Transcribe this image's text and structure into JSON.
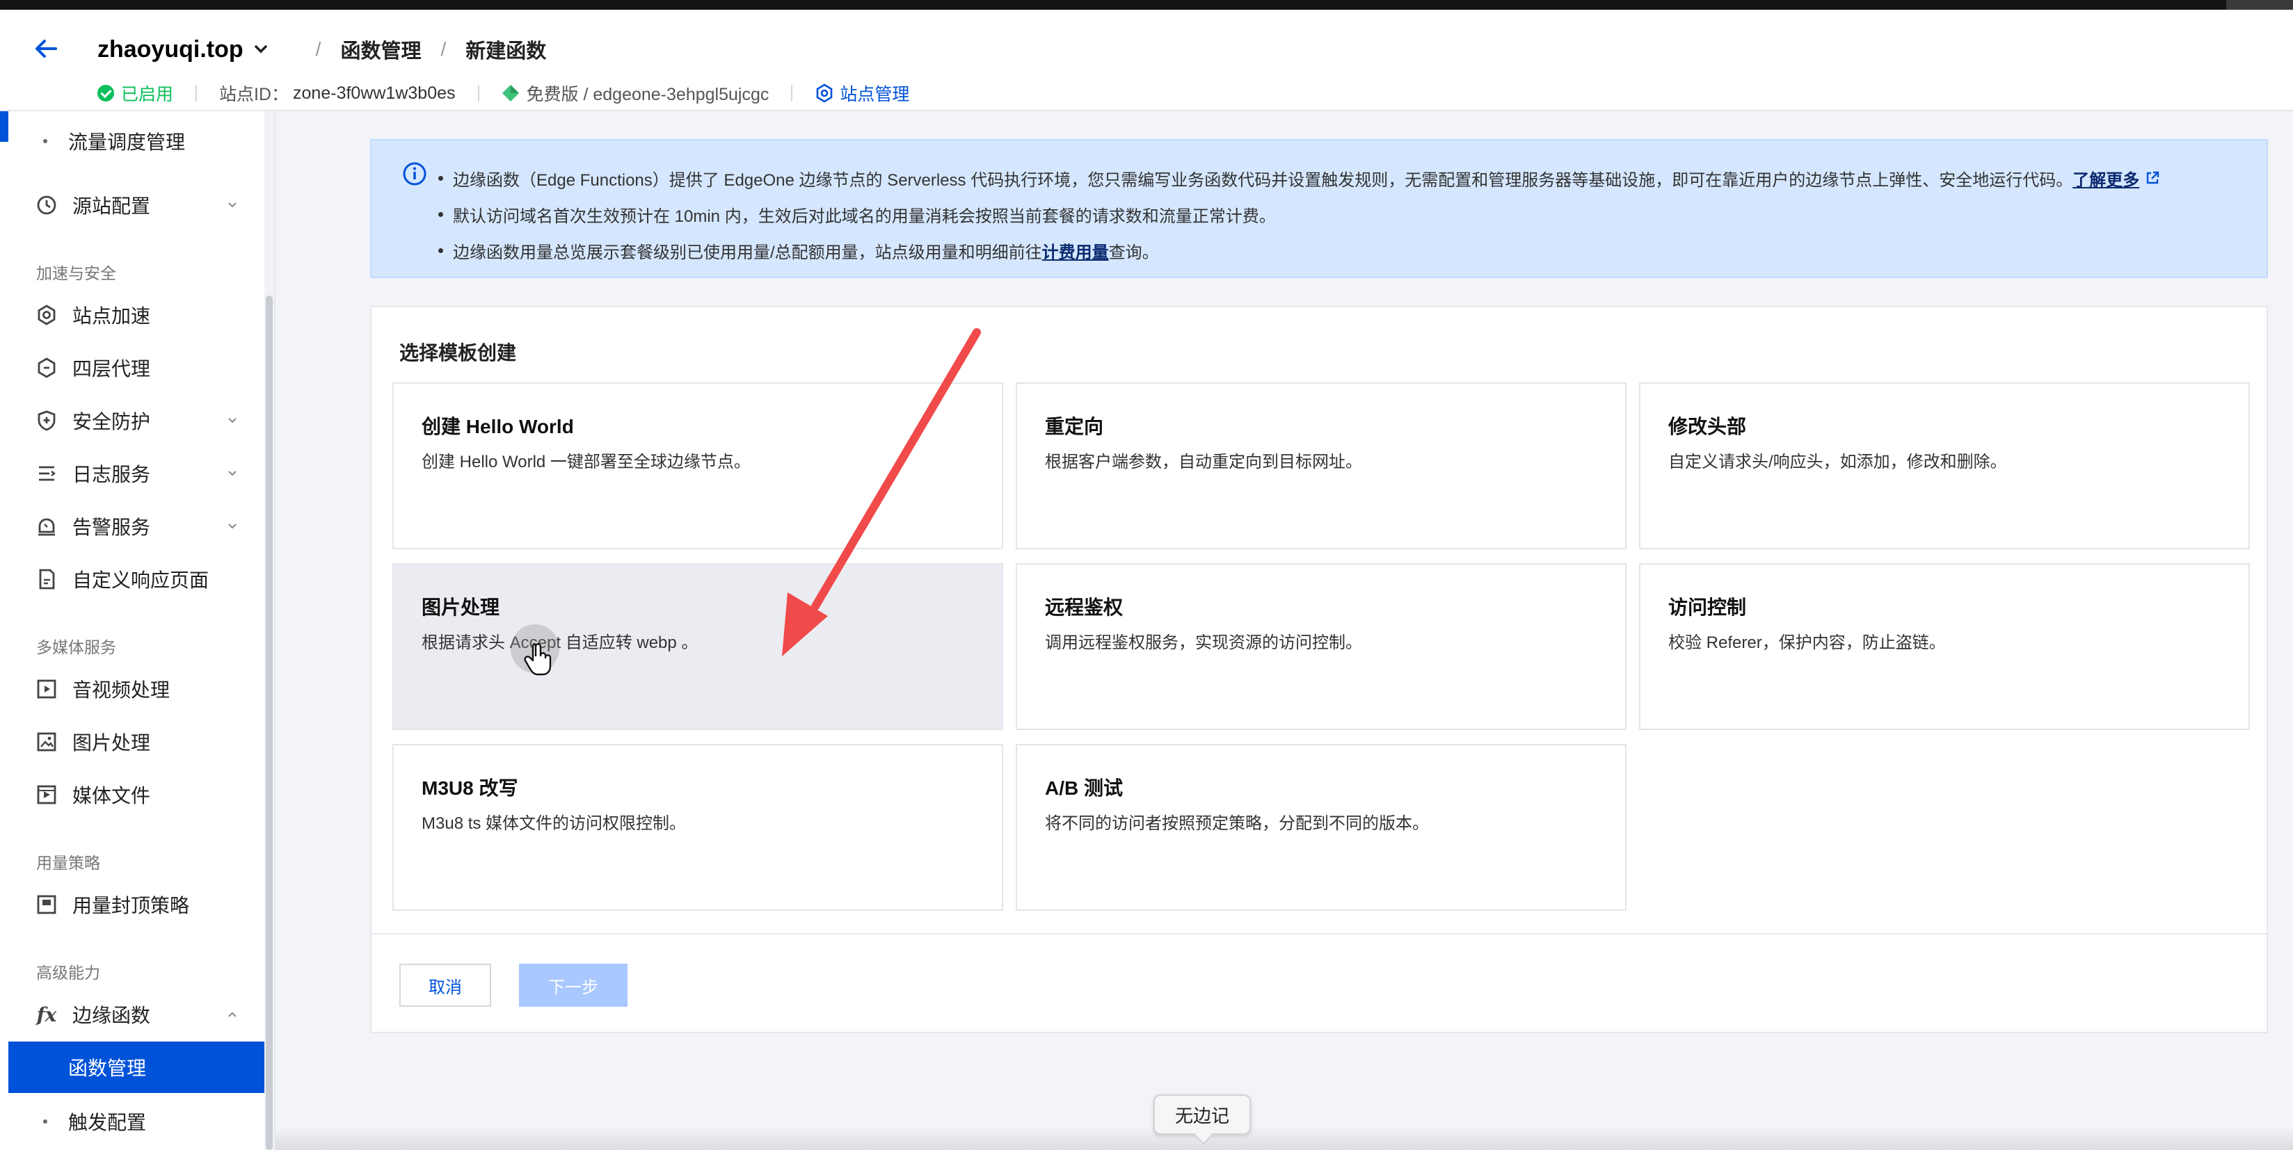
{
  "header": {
    "site_name": "zhaoyuqi.top",
    "breadcrumb_1": "函数管理",
    "breadcrumb_2": "新建函数",
    "separator": "/",
    "status": "已启用",
    "site_id_label": "站点ID：",
    "site_id": "zone-3f0ww1w3b0es",
    "plan": "免费版 / edgeone-3ehpgl5ujcgc",
    "site_manage": "站点管理"
  },
  "sidebar": {
    "items": [
      {
        "label": "流量调度管理"
      },
      {
        "label": "源站配置"
      },
      {
        "group": "加速与安全"
      },
      {
        "label": "站点加速"
      },
      {
        "label": "四层代理"
      },
      {
        "label": "安全防护"
      },
      {
        "label": "日志服务"
      },
      {
        "label": "告警服务"
      },
      {
        "label": "自定义响应页面"
      },
      {
        "group": "多媒体服务"
      },
      {
        "label": "音视频处理"
      },
      {
        "label": "图片处理"
      },
      {
        "label": "媒体文件"
      },
      {
        "group": "用量策略"
      },
      {
        "label": "用量封顶策略"
      },
      {
        "group": "高级能力"
      },
      {
        "label": "边缘函数",
        "icon_text": "fx"
      },
      {
        "label": "函数管理"
      },
      {
        "label": "触发配置"
      }
    ]
  },
  "info": {
    "line1": "边缘函数（Edge Functions）提供了 EdgeOne 边缘节点的 Serverless 代码执行环境，您只需编写业务函数代码并设置触发规则，无需配置和管理服务器等基础设施，即可在靠近用户的边缘节点上弹性、安全地运行代码。",
    "line1_link": "了解更多",
    "line2": "默认访问域名首次生效预计在 10min 内，生效后对此域名的用量消耗会按照当前套餐的请求数和流量正常计费。",
    "line3_pre": "边缘函数用量总览展示套餐级别已使用用量/总配额用量，站点级用量和明细前往",
    "line3_link": "计费用量",
    "line3_post": "查询。"
  },
  "panel": {
    "title": "选择模板创建",
    "templates": [
      {
        "title": "创建 Hello World",
        "desc": "创建 Hello World 一键部署至全球边缘节点。"
      },
      {
        "title": "重定向",
        "desc": "根据客户端参数，自动重定向到目标网址。"
      },
      {
        "title": "修改头部",
        "desc": "自定义请求头/响应头，如添加，修改和删除。"
      },
      {
        "title": "图片处理",
        "desc": "根据请求头 Accept 自适应转 webp 。"
      },
      {
        "title": "远程鉴权",
        "desc": "调用远程鉴权服务，实现资源的访问控制。"
      },
      {
        "title": "访问控制",
        "desc": "校验 Referer，保护内容，防止盗链。"
      },
      {
        "title": "M3U8 改写",
        "desc": "M3u8 ts 媒体文件的访问权限控制。"
      },
      {
        "title": "A/B 测试",
        "desc": "将不同的访问者按照预定策略，分配到不同的版本。"
      }
    ],
    "cancel_label": "取消",
    "next_label": "下一步"
  },
  "tooltip": "无边记",
  "colors": {
    "primary": "#0052d9",
    "success": "#0abf5b",
    "banner": "#d5e7ff",
    "annotation_arrow": "#f04a4a"
  }
}
